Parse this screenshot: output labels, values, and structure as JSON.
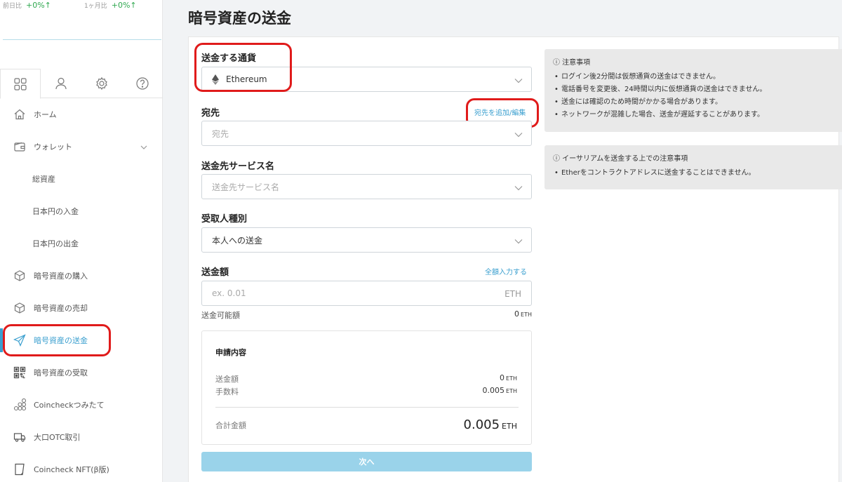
{
  "ticker": {
    "day_label": "前日比",
    "day_value": "+0%↑",
    "month_label": "1ヶ月比",
    "month_value": "+0%↑"
  },
  "sidebar": {
    "items": [
      {
        "label": "ホーム",
        "icon": "home-icon"
      },
      {
        "label": "ウォレット",
        "icon": "wallet-icon"
      },
      {
        "label": "総資産"
      },
      {
        "label": "日本円の入金"
      },
      {
        "label": "日本円の出金"
      },
      {
        "label": "暗号資産の購入",
        "icon": "cube-icon"
      },
      {
        "label": "暗号資産の売却",
        "icon": "cube-icon"
      },
      {
        "label": "暗号資産の送金",
        "icon": "send-icon",
        "active": true
      },
      {
        "label": "暗号資産の受取",
        "icon": "qr-icon"
      },
      {
        "label": "Coincheckつみたて",
        "icon": "coins-icon"
      },
      {
        "label": "大口OTC取引",
        "icon": "truck-icon"
      },
      {
        "label": "Coincheck NFT(β版)",
        "icon": "nft-icon"
      }
    ]
  },
  "page": {
    "title": "暗号資産の送金"
  },
  "form": {
    "currency_label": "送金する通貨",
    "currency_value": "Ethereum",
    "dest_label": "宛先",
    "dest_link": "宛先を追加/編集",
    "dest_placeholder": "宛先",
    "service_label": "送金先サービス名",
    "service_placeholder": "送金先サービス名",
    "recipient_label": "受取人種別",
    "recipient_value": "本人への送金",
    "amount_label": "送金額",
    "amount_link": "全額入力する",
    "amount_placeholder": "ex. 0.01",
    "amount_unit": "ETH",
    "available_label": "送金可能額",
    "available_value": "0",
    "available_unit": "ETH"
  },
  "summary": {
    "title": "申請内容",
    "amount_label": "送金額",
    "amount_value": "0",
    "fee_label": "手数料",
    "fee_value": "0.005",
    "total_label": "合計金額",
    "total_value": "0.005",
    "unit": "ETH"
  },
  "next_button": "次へ",
  "notes": [
    {
      "title": "ⓘ 注意事項",
      "items": [
        "ログイン後2分間は仮想通貨の送金はできません。",
        "電話番号を変更後、24時間以内に仮想通貨の送金はできません。",
        "送金には確認のため時間がかかる場合があります。",
        "ネットワークが混雑した場合、送金が遅延することがあります。"
      ]
    },
    {
      "title": "ⓘ イーサリアムを送金する上での注意事項",
      "items": [
        "Etherをコントラクトアドレスに送金することはできません。"
      ]
    }
  ],
  "colors": {
    "accent": "#3a9fcf",
    "highlight": "#e01b1b",
    "button": "#9ad3ea"
  }
}
